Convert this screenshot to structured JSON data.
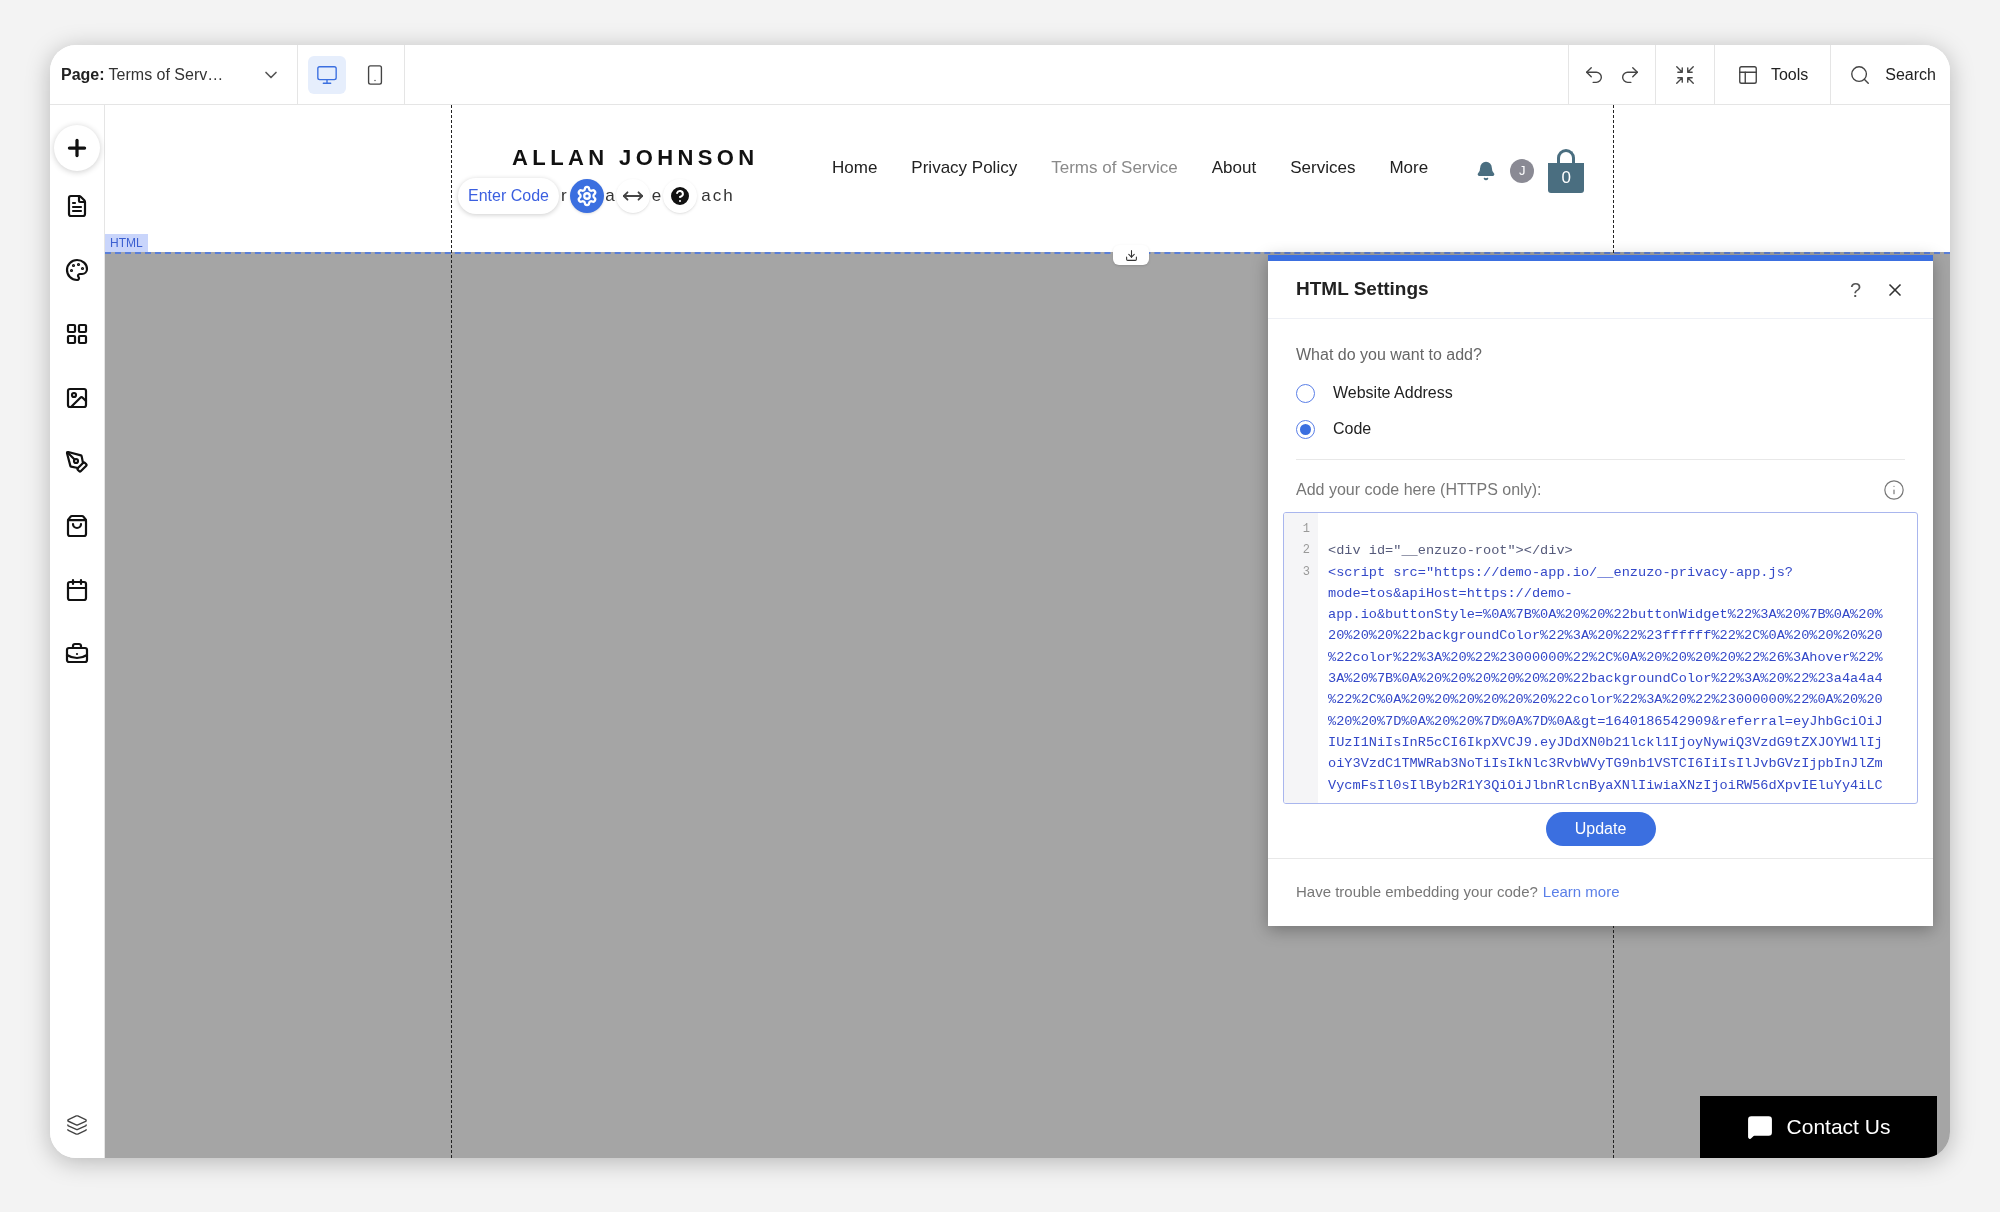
{
  "toolbar": {
    "page_label": "Page:",
    "page_name": "Terms of Serv…",
    "tools": "Tools",
    "search": "Search",
    "devices": [
      {
        "kind": "desktop",
        "selected": true
      },
      {
        "kind": "mobile",
        "selected": false
      }
    ]
  },
  "site": {
    "logo": "ALLAN JOHNSON",
    "avatar": "J",
    "cart_count": "0",
    "nav": [
      {
        "label": "Home",
        "selected": false
      },
      {
        "label": "Privacy Policy",
        "selected": false
      },
      {
        "label": "Terms of Service",
        "selected": true
      },
      {
        "label": "About",
        "selected": false
      },
      {
        "label": "Services",
        "selected": false
      },
      {
        "label": "More",
        "selected": false
      }
    ]
  },
  "element_tag": "HTML",
  "element_toolbar": {
    "button": "Enter Code",
    "fragments": [
      "r",
      "a",
      "e",
      "ach"
    ]
  },
  "dialog": {
    "title": "HTML Settings",
    "help": "?",
    "question": "What do you want to add?",
    "options": [
      {
        "label": "Website Address",
        "selected": false
      },
      {
        "label": "Code",
        "selected": true
      }
    ],
    "code_label": "Add your code here (HTTPS only):",
    "code_lines": [
      {
        "number": "1"
      },
      {
        "number": "2",
        "segments": [
          "<div id=\"__enzuzo-root\"></div>"
        ]
      },
      {
        "number": "3",
        "segments": [
          "<script src=\"https://demo-app.io/__enzuzo-privacy-app.js?",
          "mode=tos&apiHost=https://demo-",
          "app.io&buttonStyle=%0A%7B%0A%20%20%22buttonWidget%22%3A%20%7B%0A%20%",
          "20%20%20%22backgroundColor%22%3A%20%22%23ffffff%22%2C%0A%20%20%20%20",
          "%22color%22%3A%20%22%23000000%22%2C%0A%20%20%20%20%22%26%3Ahover%22%",
          "3A%20%7B%0A%20%20%20%20%20%20%22backgroundColor%22%3A%20%22%23a4a4a4",
          "%22%2C%0A%20%20%20%20%20%20%22color%22%3A%20%22%23000000%22%0A%20%20",
          "%20%20%7D%0A%20%20%7D%0A%7D%0A&gt=1640186542909&referral=eyJhbGciOiJ",
          "IUzI1NiIsInR5cCI6IkpXVCJ9.eyJDdXN0b21lckl1IjoyNywiQ3VzdG9tZXJOYW1lIj",
          "oiY3VzdC1TMWRab3NoTiIsIkNlc3RvbWVyTG9nb1VSTCI6IiIsIlJvbGVzIjpbInJlZm",
          "VycmFsIl0sIlByb2R1Y3QiOiJlbnRlcnByaXNlIiwiaXNzIjoiRW56dXpvIEluYy4iLC"
        ]
      }
    ],
    "update": "Update",
    "footer": "Have trouble embedding your code?",
    "footer_link": "Learn more"
  },
  "contact_button": "Contact Us"
}
